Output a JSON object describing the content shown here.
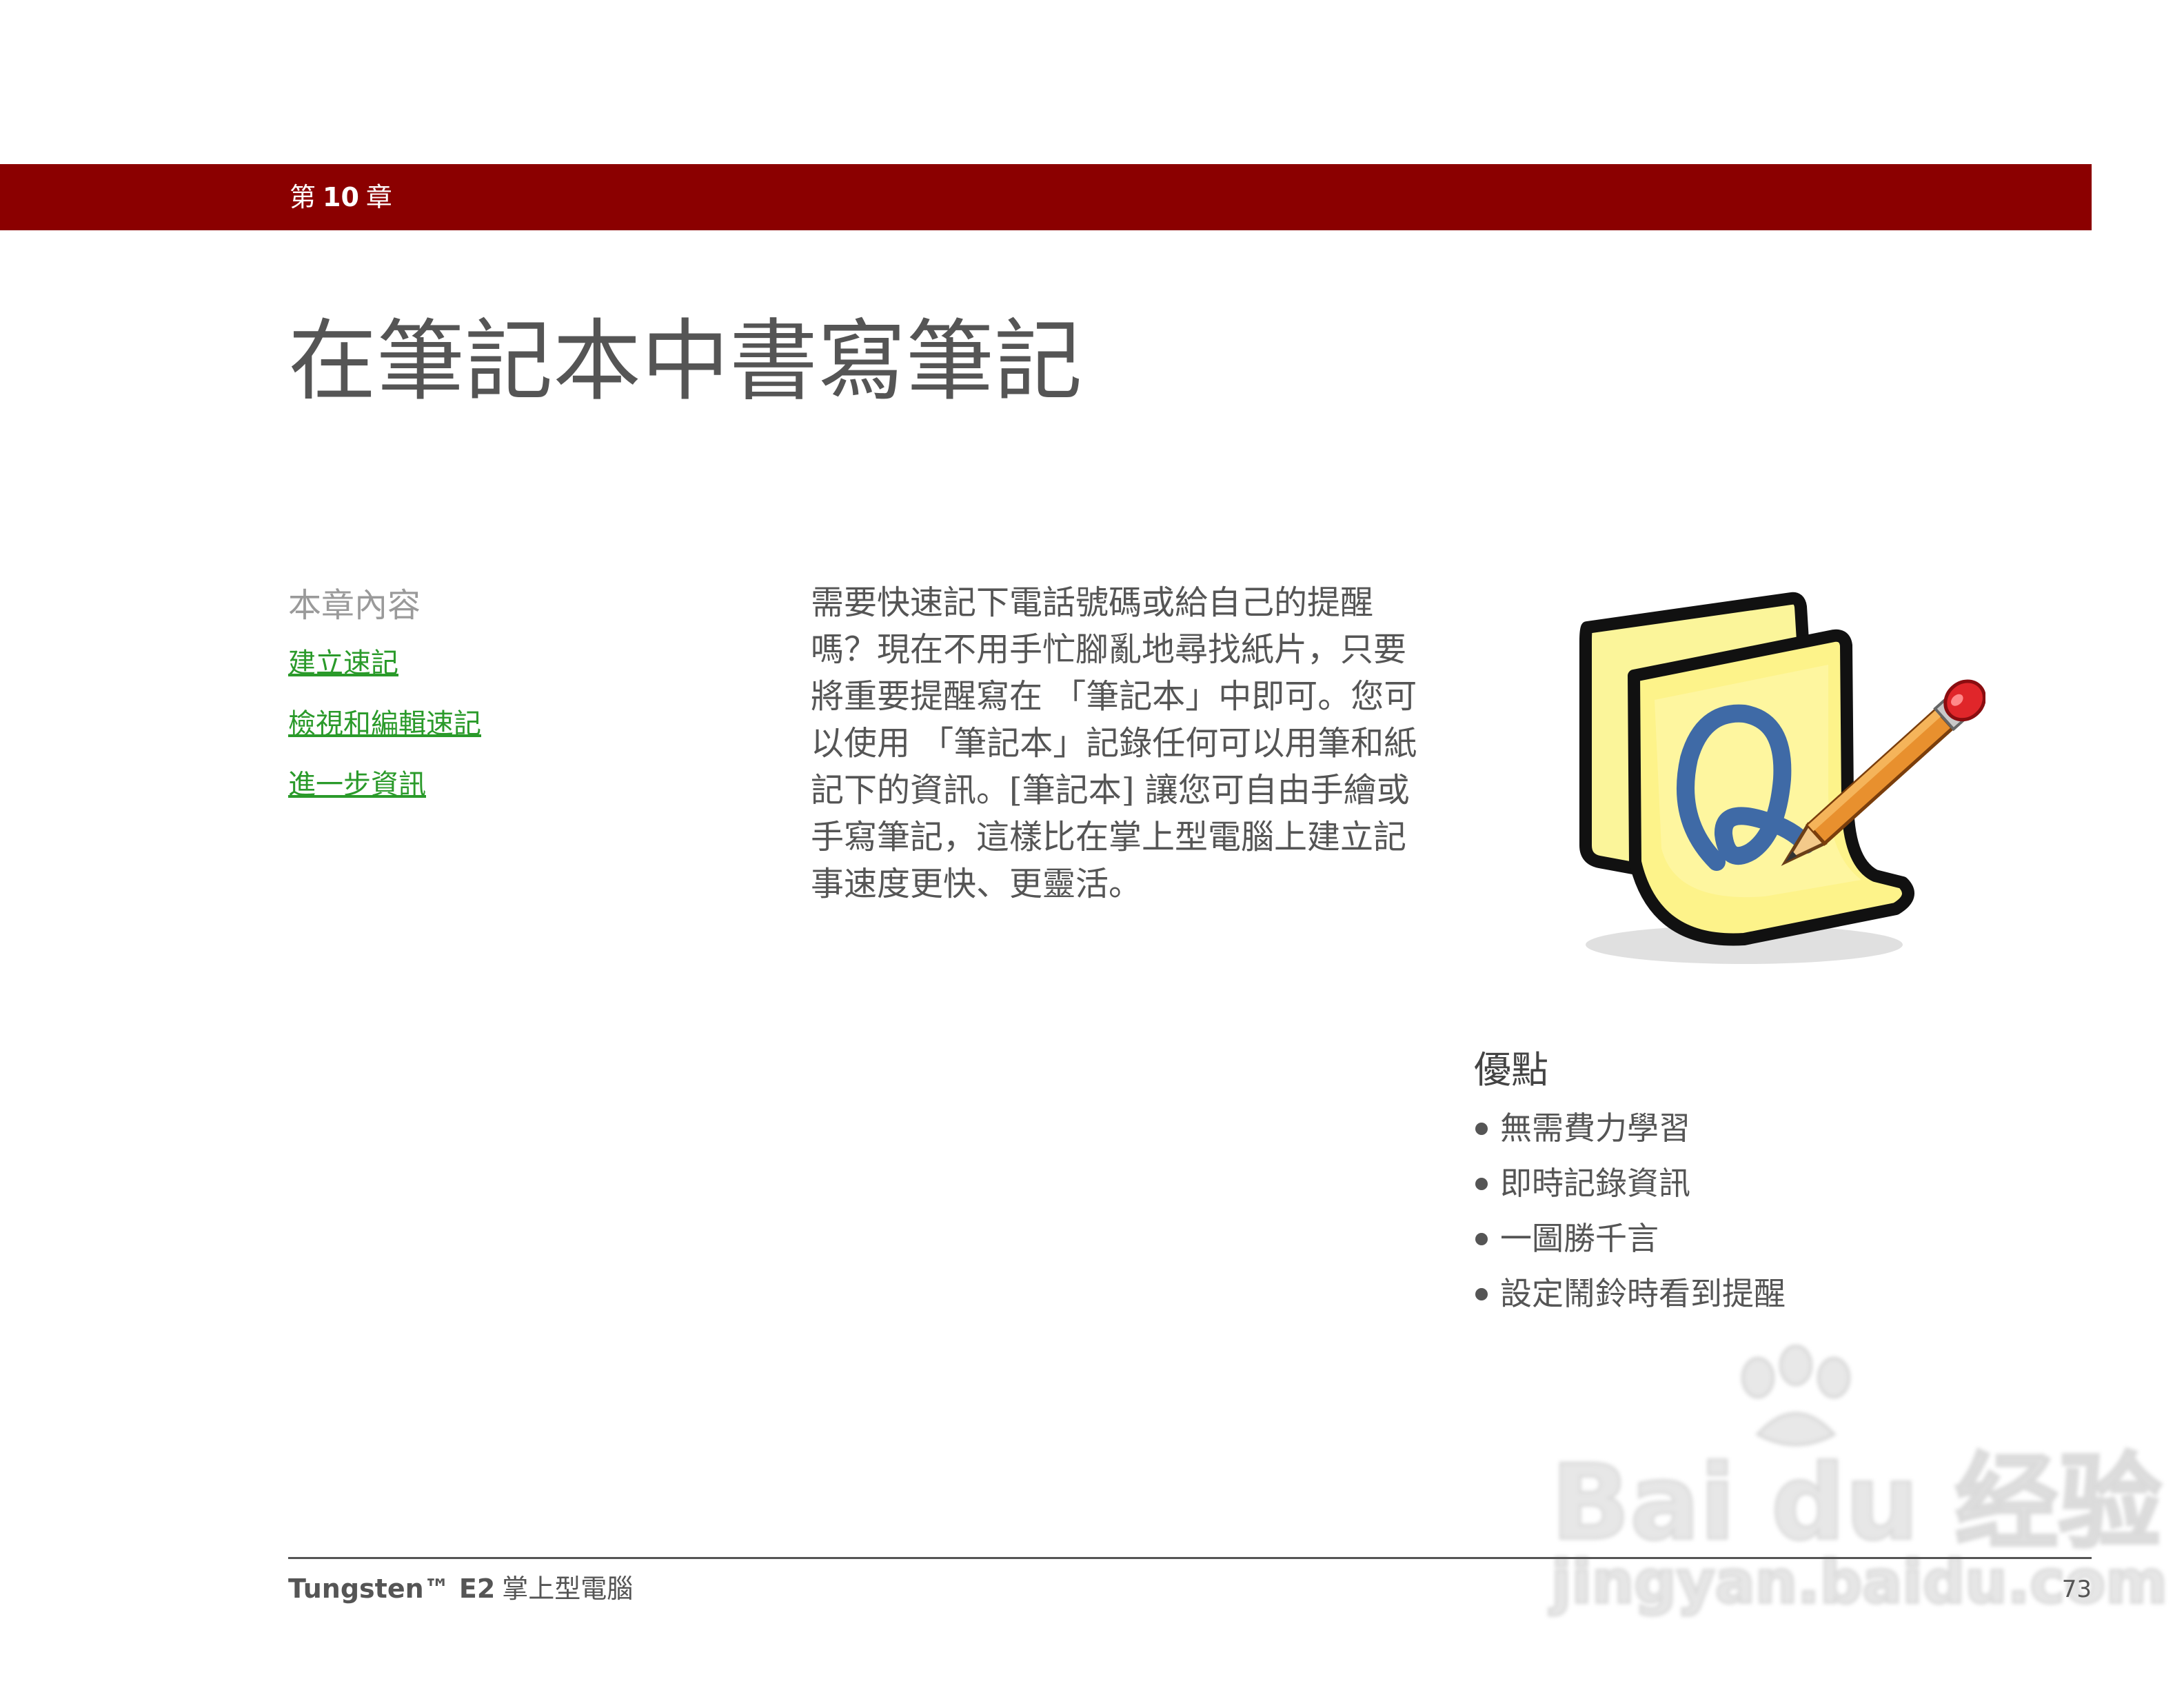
{
  "header": {
    "chapter_prefix": "第",
    "chapter_number": "10",
    "chapter_suffix": "章"
  },
  "page_title": "在筆記本中書寫筆記",
  "toc": {
    "heading": "本章內容",
    "links": [
      "建立速記",
      "檢視和編輯速記",
      "進一步資訊"
    ]
  },
  "intro": {
    "lines": [
      "需要快速記下電話號碼或給自己的提醒",
      "嗎？現在不用手忙腳亂地尋找紙片，只要",
      "將重要提醒寫在 「筆記本」中即可。您可",
      "以使用 「筆記本」記錄任何可以用筆和紙",
      "記下的資訊。[筆記本] 讓您可自由手繪或",
      "手寫筆記，這樣比在掌上型電腦上建立記",
      "事速度更快、更靈活。"
    ]
  },
  "icon": {
    "name": "note-pad-icon"
  },
  "benefits": {
    "heading": "優點",
    "items": [
      "無需費力學習",
      "即時記錄資訊",
      "一圖勝千言",
      "設定鬧鈴時看到提醒"
    ]
  },
  "watermark": {
    "main": "Bai du 经验",
    "sub": "jingyan.baidu.com"
  },
  "footer": {
    "brand": "Tungsten™ E2",
    "product": "掌上型電腦",
    "page_number": "73"
  },
  "colors": {
    "chapter_bar": "#8b0000",
    "link": "#2a9a2a",
    "body_text": "#555555"
  }
}
